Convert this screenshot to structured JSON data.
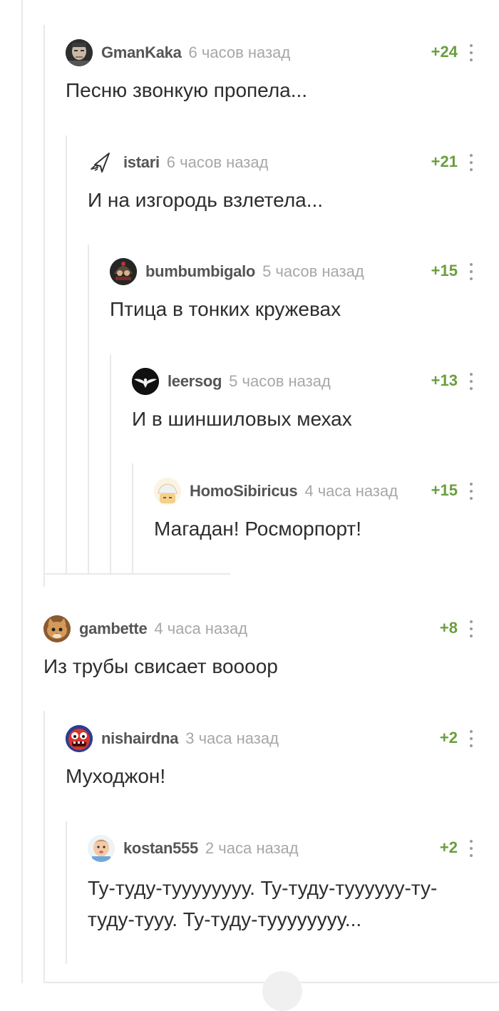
{
  "comments": [
    {
      "author": "GmanKaka",
      "time": "6 часов назад",
      "rating": "+24",
      "text": "Песню звонкую пропела...",
      "avatar": "face-avatar"
    },
    {
      "author": "istari",
      "time": "6 часов назад",
      "rating": "+21",
      "text": "И на изгородь взлетела...",
      "avatar": "cursor-avatar"
    },
    {
      "author": "bumbumbigalo",
      "time": "5 часов назад",
      "rating": "+15",
      "text": "Птица в тонких кружевах",
      "avatar": "helmet-avatar"
    },
    {
      "author": "leersog",
      "time": "5 часов назад",
      "rating": "+13",
      "text": "И в шиншиловых мехах",
      "avatar": "eagle-avatar"
    },
    {
      "author": "HomoSibiricus",
      "time": "4 часа назад",
      "rating": "+15",
      "text": "Магадан! Росморпорт!",
      "avatar": "cartoon-avatar"
    },
    {
      "author": "gambette",
      "time": "4 часа назад",
      "rating": "+8",
      "text": "Из трубы свисает воооор",
      "avatar": "cat-avatar"
    },
    {
      "author": "nishairdna",
      "time": "3 часа назад",
      "rating": "+2",
      "text": "Муходжон!",
      "avatar": "monster-avatar"
    },
    {
      "author": "kostan555",
      "time": "2 часа назад",
      "rating": "+2",
      "text": "Ту-туду-туууууууу. Ту-туду-туууууу-ту-туду-тууу. Ту-туду-туууууууу...",
      "avatar": "baby-avatar"
    }
  ],
  "colors": {
    "rating": "#6a9e3d",
    "thread_line": "#e9e9e9",
    "time": "#a7a7a7"
  }
}
